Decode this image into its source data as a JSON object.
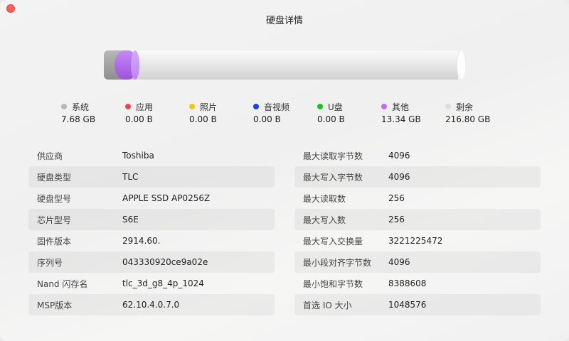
{
  "window": {
    "title": "硬盘详情"
  },
  "disk_bar": {
    "segments": [
      {
        "name": "系统",
        "color": "#a0a0a0"
      },
      {
        "name": "其他",
        "color": "#b06ae9"
      },
      {
        "name": "剩余",
        "color": "#e6e6e6"
      }
    ]
  },
  "legend": [
    {
      "label": "系统",
      "value": "7.68 GB",
      "color": "#b9b9b9"
    },
    {
      "label": "应用",
      "value": "0.00 B",
      "color": "#e84a4a"
    },
    {
      "label": "照片",
      "value": "0.00 B",
      "color": "#f7c21b"
    },
    {
      "label": "音视频",
      "value": "0.00 B",
      "color": "#1f3fe0"
    },
    {
      "label": "U盘",
      "value": "0.00 B",
      "color": "#1fbf1f"
    },
    {
      "label": "其他",
      "value": "13.34 GB",
      "color": "#c16cf1"
    },
    {
      "label": "剩余",
      "value": "216.80 GB",
      "color": "#dedede"
    }
  ],
  "left_table": [
    {
      "label": "供应商",
      "value": "Toshiba"
    },
    {
      "label": "硬盘类型",
      "value": "TLC"
    },
    {
      "label": "硬盘型号",
      "value": "APPLE SSD AP0256Z"
    },
    {
      "label": "芯片型号",
      "value": "S6E"
    },
    {
      "label": "固件版本",
      "value": "2914.60."
    },
    {
      "label": "序列号",
      "value": "043330920ce9a02e"
    },
    {
      "label": "Nand 闪存名",
      "value": "tlc_3d_g8_4p_1024"
    },
    {
      "label": "MSP版本",
      "value": "62.10.4.0.7.0"
    }
  ],
  "right_table": [
    {
      "label": "最大读取字节数",
      "value": "4096"
    },
    {
      "label": "最大写入字节数",
      "value": "4096"
    },
    {
      "label": "最大读取数",
      "value": "256"
    },
    {
      "label": "最大写入数",
      "value": "256"
    },
    {
      "label": "最大写入交换量",
      "value": "3221225472"
    },
    {
      "label": "最小段对齐字节数",
      "value": "4096"
    },
    {
      "label": "最小饱和字节数",
      "value": "8388608"
    },
    {
      "label": "首选 IO 大小",
      "value": "1048576"
    }
  ]
}
